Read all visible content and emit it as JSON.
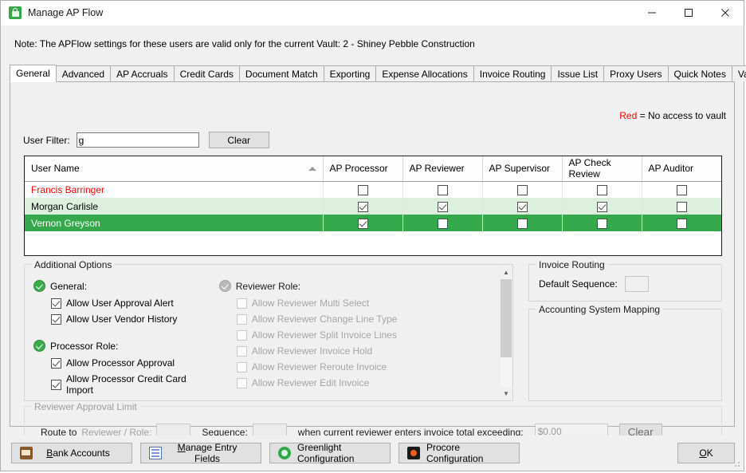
{
  "window": {
    "title": "Manage AP Flow",
    "icon": "lock-icon",
    "minimize": "minimize-icon",
    "maximize": "maximize-icon",
    "close": "close-icon"
  },
  "note": "Note:  The APFlow settings for these users are valid only for the current Vault: 2 - Shiney Pebble Construction",
  "tabs": [
    {
      "label": "General",
      "active": true
    },
    {
      "label": "Advanced",
      "active": false
    },
    {
      "label": "AP Accruals",
      "active": false
    },
    {
      "label": "Credit Cards",
      "active": false
    },
    {
      "label": "Document Match",
      "active": false
    },
    {
      "label": "Exporting",
      "active": false
    },
    {
      "label": "Expense Allocations",
      "active": false
    },
    {
      "label": "Invoice Routing",
      "active": false
    },
    {
      "label": "Issue List",
      "active": false
    },
    {
      "label": "Proxy Users",
      "active": false
    },
    {
      "label": "Quick Notes",
      "active": false
    },
    {
      "label": "Validation",
      "active": false
    }
  ],
  "legend": {
    "red_word": "Red",
    "text": " = No access to vault",
    "red_color": "#ff0000"
  },
  "filter": {
    "label": "User Filter:",
    "value": "g",
    "placeholder": "",
    "clear_label": "Clear"
  },
  "grid": {
    "columns": [
      "User Name",
      "AP Processor",
      "AP Reviewer",
      "AP Supervisor",
      "AP Check Review",
      "AP Auditor"
    ],
    "sort_indicator": "sort-ascending-icon",
    "rows": [
      {
        "name": "Francis Barringer",
        "style": "red",
        "ap_processor": false,
        "ap_reviewer": false,
        "ap_supervisor": false,
        "ap_check_review": false,
        "ap_auditor": false
      },
      {
        "name": "Morgan Carlisle",
        "style": "alt",
        "ap_processor": true,
        "ap_reviewer": true,
        "ap_supervisor": true,
        "ap_check_review": true,
        "ap_auditor": false
      },
      {
        "name": "Vernon Greyson",
        "style": "selected",
        "ap_processor": true,
        "ap_reviewer": false,
        "ap_supervisor": false,
        "ap_check_review": false,
        "ap_auditor": false
      }
    ]
  },
  "additional_options": {
    "caption": "Additional Options",
    "general": {
      "label": "General:",
      "enabled": true,
      "items": [
        {
          "label": "Allow User Approval Alert",
          "checked": true,
          "enabled": true
        },
        {
          "label": "Allow User Vendor History",
          "checked": true,
          "enabled": true
        }
      ]
    },
    "processor_role": {
      "label": "Processor Role:",
      "enabled": true,
      "items": [
        {
          "label": "Allow Processor Approval",
          "checked": true,
          "enabled": true
        },
        {
          "label": "Allow Processor Credit Card Import",
          "checked": true,
          "enabled": true
        }
      ]
    },
    "reviewer_role": {
      "label": "Reviewer Role:",
      "enabled": false,
      "items": [
        {
          "label": "Allow Reviewer Multi Select",
          "checked": false,
          "enabled": false
        },
        {
          "label": "Allow Reviewer Change Line Type",
          "checked": false,
          "enabled": false
        },
        {
          "label": "Allow Reviewer Split Invoice Lines",
          "checked": false,
          "enabled": false
        },
        {
          "label": "Allow Reviewer Invoice Hold",
          "checked": false,
          "enabled": false
        },
        {
          "label": "Allow Reviewer Reroute Invoice",
          "checked": false,
          "enabled": false
        },
        {
          "label": "Allow Reviewer Edit Invoice",
          "checked": false,
          "enabled": false
        }
      ]
    }
  },
  "invoice_routing": {
    "caption": "Invoice Routing",
    "default_sequence_label": "Default Sequence:",
    "default_sequence_value": ""
  },
  "accounting_system_mapping": {
    "caption": "Accounting System Mapping"
  },
  "reviewer_approval_limit": {
    "caption": "Reviewer Approval Limit",
    "route_to_label": "Route to",
    "reviewer_role_label": "Reviewer / Role:",
    "reviewer_role_value": "",
    "sequence_label": "Sequence:",
    "sequence_value": "",
    "exceeding_label": "when current reviewer enters invoice total exceeding:",
    "amount_value": "$0.00",
    "clear_label": "Clear"
  },
  "bottom_buttons": {
    "bank_accounts": {
      "label": "Bank Accounts",
      "accel": "B",
      "icon": "bank-book-icon"
    },
    "manage_entry_fields": {
      "label": "Manage Entry Fields",
      "accel": "M",
      "icon": "form-fields-icon"
    },
    "greenlight_configuration": {
      "label": "Greenlight Configuration",
      "icon": "greenlight-logo-icon"
    },
    "procore_configuration": {
      "label": "Procore Configuration",
      "icon": "procore-logo-icon"
    },
    "ok": {
      "label": "OK",
      "accel": "O"
    }
  }
}
